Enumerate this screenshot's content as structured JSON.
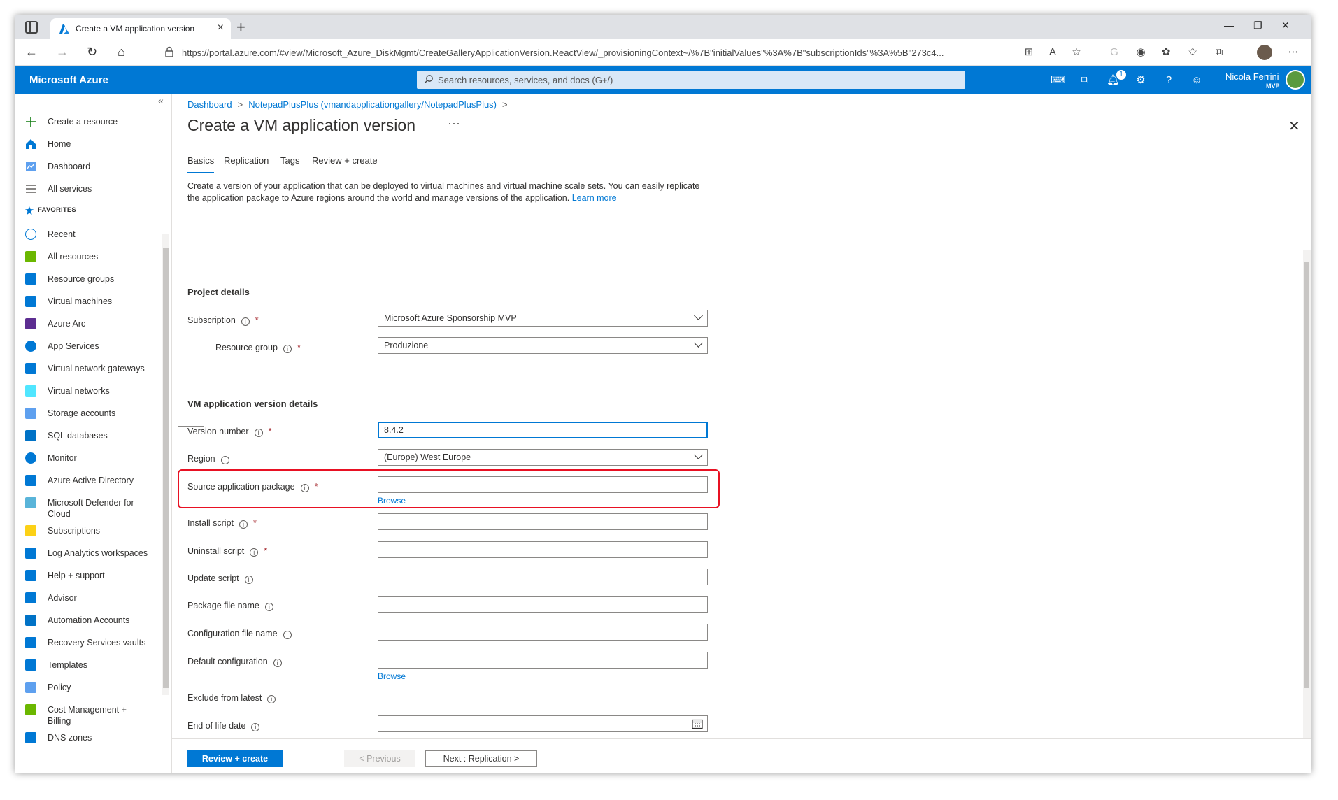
{
  "browser": {
    "tab_title": "Create a VM application version",
    "tab_close": "×",
    "new_tab": "+",
    "url": "https://portal.azure.com/#view/Microsoft_Azure_DiskMgmt/CreateGalleryApplicationVersion.ReactView/_provisioningContext~/%7B\"initialValues\"%3A%7B\"subscriptionIds\"%3A%5B\"273c4...",
    "window_controls": [
      "—",
      "❐",
      "✕"
    ]
  },
  "header": {
    "brand": "Microsoft Azure",
    "search_placeholder": "Search resources, services, and docs (G+/)",
    "notification_count": "1",
    "user_name": "Nicola Ferrini",
    "user_tag": "MVP"
  },
  "sidebar": {
    "collapse_glyph": "«",
    "favorites_label": "FAVORITES",
    "top_items": [
      {
        "label": "Create a resource",
        "icon": "plus-icon"
      },
      {
        "label": "Home",
        "icon": "home-icon"
      },
      {
        "label": "Dashboard",
        "icon": "dashboard-icon"
      },
      {
        "label": "All services",
        "icon": "list-icon"
      }
    ],
    "items": [
      {
        "label": "Recent",
        "icon": "clock-icon"
      },
      {
        "label": "All resources",
        "icon": "grid-icon"
      },
      {
        "label": "Resource groups",
        "icon": "resource-group-icon"
      },
      {
        "label": "Virtual machines",
        "icon": "vm-icon"
      },
      {
        "label": "Azure Arc",
        "icon": "arc-icon"
      },
      {
        "label": "App Services",
        "icon": "globe-icon"
      },
      {
        "label": "Virtual network gateways",
        "icon": "lock-icon"
      },
      {
        "label": "Virtual networks",
        "icon": "vnet-icon"
      },
      {
        "label": "Storage accounts",
        "icon": "storage-icon"
      },
      {
        "label": "SQL databases",
        "icon": "sql-icon"
      },
      {
        "label": "Monitor",
        "icon": "monitor-icon"
      },
      {
        "label": "Azure Active Directory",
        "icon": "aad-icon"
      },
      {
        "label": "Microsoft Defender for",
        "label2": "Cloud",
        "icon": "shield-icon"
      },
      {
        "label": "Subscriptions",
        "icon": "key-icon"
      },
      {
        "label": "Log Analytics workspaces",
        "icon": "analytics-icon"
      },
      {
        "label": "Help + support",
        "icon": "person-icon"
      },
      {
        "label": "Advisor",
        "icon": "advisor-icon"
      },
      {
        "label": "Automation Accounts",
        "icon": "gear-icon"
      },
      {
        "label": "Recovery Services vaults",
        "icon": "cloud-icon"
      },
      {
        "label": "Templates",
        "icon": "template-icon"
      },
      {
        "label": "Policy",
        "icon": "policy-icon"
      },
      {
        "label": "Cost Management +",
        "label2": "Billing",
        "icon": "cost-icon"
      },
      {
        "label": "DNS zones",
        "icon": "dns-icon"
      }
    ]
  },
  "breadcrumb": {
    "items": [
      "Dashboard",
      "NotepadPlusPlus (vmandapplicationgallery/NotepadPlusPlus)"
    ],
    "sep": ">"
  },
  "page": {
    "title": "Create a VM application version",
    "more": "···",
    "close": "✕"
  },
  "tabs": [
    "Basics",
    "Replication",
    "Tags",
    "Review + create"
  ],
  "intro": {
    "text": "Create a version of your application that can be deployed to virtual machines and virtual machine scale sets. You can easily replicate the application package to Azure regions around the world and manage versions of the application.",
    "link": "Learn more"
  },
  "project_details": {
    "title": "Project details",
    "subscription_label": "Subscription",
    "subscription_value": "Microsoft Azure Sponsorship MVP",
    "resource_group_label": "Resource group",
    "resource_group_value": "Produzione"
  },
  "version_details": {
    "title": "VM application version details",
    "version_label": "Version number",
    "version_value": "8.4.2",
    "region_label": "Region",
    "region_value": "(Europe) West Europe",
    "source_label": "Source application package",
    "source_value": "",
    "browse": "Browse",
    "install_label": "Install script",
    "uninstall_label": "Uninstall script",
    "update_label": "Update script",
    "package_label": "Package file name",
    "config_file_label": "Configuration file name",
    "default_config_label": "Default configuration",
    "exclude_label": "Exclude from latest",
    "eol_label": "End of life date"
  },
  "footer": {
    "review": "Review + create",
    "previous": "< Previous",
    "next": "Next : Replication >"
  },
  "colors": {
    "azure_blue": "#0078d4",
    "highlight": "#e81123",
    "required": "#a4262c"
  }
}
